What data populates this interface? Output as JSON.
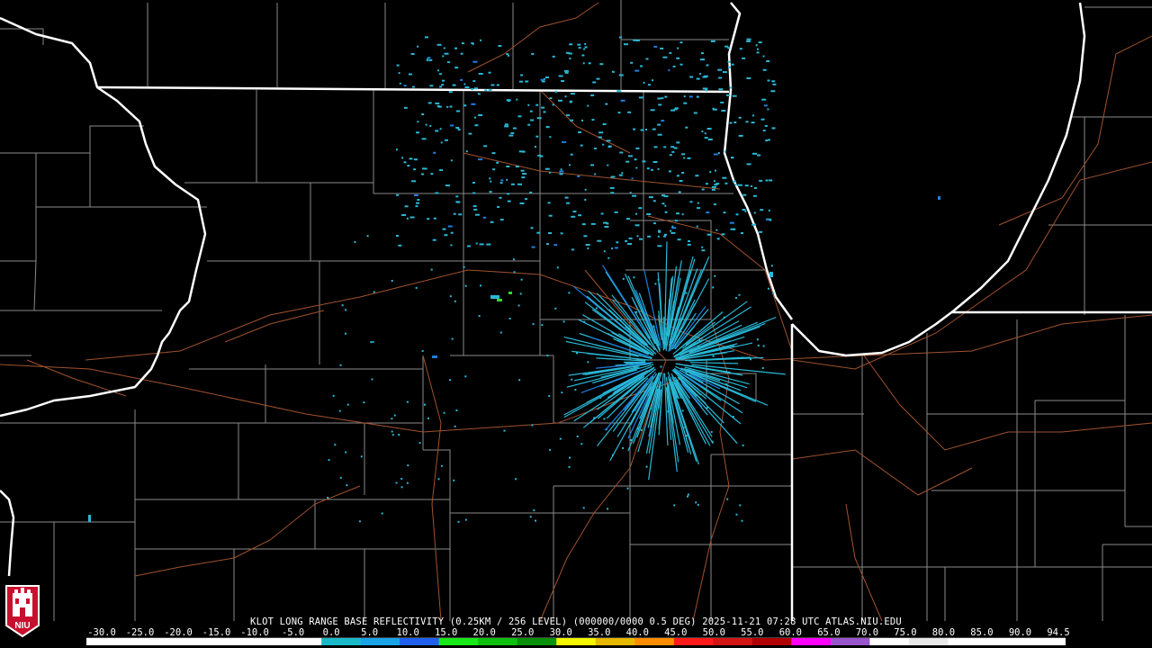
{
  "product": {
    "caption": "KLOT LONG RANGE BASE REFLECTIVITY (0.25KM / 256 LEVEL) (000000/0000 0.5 DEG) 2025-11-21 07:28 UTC  ATLAS.NIU.EDU"
  },
  "logo": {
    "text": "NIU"
  },
  "colorbar": {
    "labels": [
      "-30.0",
      "-25.0",
      "-20.0",
      "-15.0",
      "-10.0",
      "-5.0",
      "0.0",
      "5.0",
      "10.0",
      "15.0",
      "20.0",
      "25.0",
      "30.0",
      "35.0",
      "40.0",
      "45.0",
      "50.0",
      "55.0",
      "60.0",
      "65.0",
      "70.0",
      "75.0",
      "80.0",
      "85.0",
      "90.0",
      "94.5"
    ],
    "colors": [
      "#000000",
      "#000000",
      "#000000",
      "#000000",
      "#000000",
      "#000000",
      "#1ab9c9",
      "#19a4e8",
      "#1f60f0",
      "#17e817",
      "#0ec00e",
      "#089008",
      "#f5f500",
      "#e6b800",
      "#ff8c00",
      "#ff1a1a",
      "#d41414",
      "#b00000",
      "#ff00ff",
      "#9955cc",
      "#ffffff",
      "#e8e8e8",
      "#ffffff",
      "#ffffff",
      "#ffffff"
    ]
  },
  "map_colors": {
    "state_border": "#ffffff",
    "county_line": "#8a8a8a",
    "highway": "#a0522d",
    "echo": "#29b8d6",
    "echo_strong": "#1e7fe0",
    "echo_green": "#2ed82e"
  }
}
